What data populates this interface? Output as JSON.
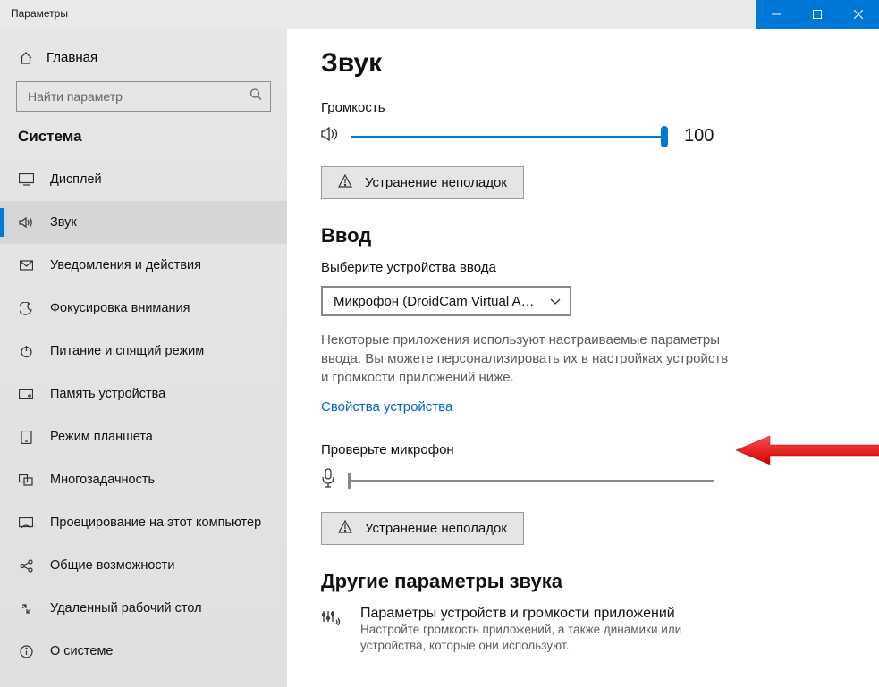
{
  "titlebar": {
    "label": "Параметры"
  },
  "sidebar": {
    "home": "Главная",
    "search_placeholder": "Найти параметр",
    "section": "Система",
    "items": [
      {
        "label": "Дисплей"
      },
      {
        "label": "Звук"
      },
      {
        "label": "Уведомления и действия"
      },
      {
        "label": "Фокусировка внимания"
      },
      {
        "label": "Питание и спящий режим"
      },
      {
        "label": "Память устройства"
      },
      {
        "label": "Режим планшета"
      },
      {
        "label": "Многозадачность"
      },
      {
        "label": "Проецирование на этот компьютер"
      },
      {
        "label": "Общие возможности"
      },
      {
        "label": "Удаленный рабочий стол"
      },
      {
        "label": "О системе"
      }
    ]
  },
  "content": {
    "title": "Звук",
    "volume_label": "Громкость",
    "volume_value": "100",
    "troubleshoot": "Устранение неполадок",
    "input_section": "Ввод",
    "choose_input": "Выберите устройства ввода",
    "input_device": "Микрофон (DroidCam Virtual Au...",
    "input_desc": "Некоторые приложения используют настраиваемые параметры ввода. Вы можете персонализировать их в настройках устройств и громкости приложений ниже.",
    "device_props_link": "Свойства устройства",
    "test_mic": "Проверьте микрофон",
    "other_section": "Другие параметры звука",
    "other_title": "Параметры устройств и громкости приложений",
    "other_sub": "Настройте громкость приложений, а также динамики или устройства, которые они используют."
  }
}
